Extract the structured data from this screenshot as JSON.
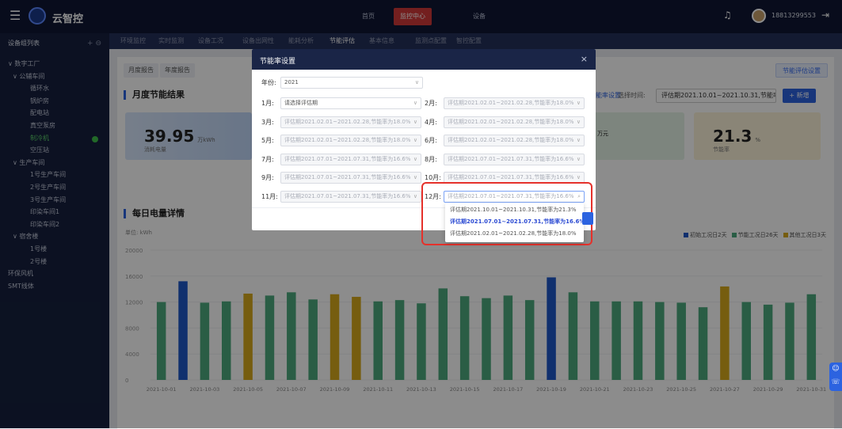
{
  "app": {
    "title": "云智控"
  },
  "nav": [
    {
      "label": "首页"
    },
    {
      "label": "监控中心"
    },
    {
      "label": "设备"
    }
  ],
  "user": {
    "phone": "18813299553"
  },
  "sidebar": {
    "header": "设备组列表",
    "nodes": [
      {
        "label": "数字工厂",
        "level": 0,
        "caret": "∨"
      },
      {
        "label": "公辅车间",
        "level": 1,
        "caret": "∨"
      },
      {
        "label": "循环水",
        "level": 2
      },
      {
        "label": "锅炉房",
        "level": 2
      },
      {
        "label": "配电站",
        "level": 2
      },
      {
        "label": "真空泵房",
        "level": 2
      },
      {
        "label": "制冷机",
        "level": 2,
        "selected": true
      },
      {
        "label": "空压站",
        "level": 2
      },
      {
        "label": "生产车间",
        "level": 1,
        "caret": "∨"
      },
      {
        "label": "1号生产车间",
        "level": 2
      },
      {
        "label": "2号生产车间",
        "level": 2
      },
      {
        "label": "3号生产车间",
        "level": 2
      },
      {
        "label": "印染车间1",
        "level": 2
      },
      {
        "label": "印染车间2",
        "level": 2
      },
      {
        "label": "宿舍楼",
        "level": 1,
        "caret": "∨"
      },
      {
        "label": "1号楼",
        "level": 2
      },
      {
        "label": "2号楼",
        "level": 2
      },
      {
        "label": "环保风机",
        "level": 0
      },
      {
        "label": "SMT线体",
        "level": 0
      }
    ]
  },
  "tabs": [
    "环境监控",
    "实时监测",
    "设备工况",
    "设备出网性",
    "能耗分析",
    "节能评估",
    "基本信息",
    "监测点配置",
    "智控配置"
  ],
  "active_tab": "节能评估",
  "subtabs": [
    "月度报告",
    "年度报告"
  ],
  "plan_button": "节能评估设置",
  "section_monthly": "月度节能结果",
  "section_daily": "每日电量详情",
  "filter": {
    "link": "节能率设置",
    "time_label": "选择时间:",
    "time_value": "评估期2021.10.01~2021.10.31,节能率为2...",
    "add": "+ 新增"
  },
  "cards": {
    "consumption_value": "39.95",
    "consumption_unit": "万kWh",
    "consumption_desc": "消耗电量",
    "money_unit": "万元",
    "rate_value": "21.3",
    "rate_unit": "%",
    "rate_desc": "节能率"
  },
  "chart_data": {
    "type": "bar",
    "ylabel": "单位: kWh",
    "ylim": [
      0,
      20000
    ],
    "yticks": [
      0,
      4000,
      8000,
      12000,
      16000,
      20000
    ],
    "legend": [
      "初始工况日2天",
      "节能工况日26天",
      "其他工况日3天"
    ],
    "colors": {
      "初始工况日2天": "#1e58c8",
      "节能工况日26天": "#4ea97e",
      "其他工况日3天": "#d8a91d"
    },
    "x_labels": [
      "2021-10-01",
      "2021-10-03",
      "2021-10-05",
      "2021-10-07",
      "2021-10-09",
      "2021-10-11",
      "2021-10-13",
      "2021-10-15",
      "2021-10-17",
      "2021-10-19",
      "2021-10-21",
      "2021-10-23",
      "2021-10-25",
      "2021-10-27",
      "2021-10-29",
      "2021-10-31"
    ],
    "values": [
      12000,
      15200,
      11900,
      12100,
      13300,
      13000,
      13500,
      12400,
      13200,
      12800,
      12100,
      12300,
      11800,
      14100,
      12900,
      12600,
      13000,
      12300,
      15800,
      13500,
      12100,
      12100,
      12100,
      12000,
      11900,
      11200,
      14400,
      12000,
      11600,
      11900,
      13200
    ],
    "kinds": [
      "s",
      "b",
      "s",
      "s",
      "o",
      "s",
      "s",
      "s",
      "o",
      "o",
      "s",
      "s",
      "s",
      "s",
      "s",
      "s",
      "s",
      "s",
      "b",
      "s",
      "s",
      "s",
      "s",
      "s",
      "s",
      "s",
      "o",
      "s",
      "s",
      "s",
      "s"
    ]
  },
  "dialog": {
    "title": "节能率设置",
    "close": "×",
    "year_label": "年份:",
    "year_value": "2021",
    "months": [
      {
        "label": "1月:",
        "value": "请选择评估期"
      },
      {
        "label": "2月:",
        "value": "评估期2021.02.01~2021.02.28,节能率为18.0%"
      },
      {
        "label": "3月:",
        "value": "评估期2021.02.01~2021.02.28,节能率为18.0%"
      },
      {
        "label": "4月:",
        "value": "评估期2021.02.01~2021.02.28,节能率为18.0%"
      },
      {
        "label": "5月:",
        "value": "评估期2021.02.01~2021.02.28,节能率为18.0%"
      },
      {
        "label": "6月:",
        "value": "评估期2021.02.01~2021.02.28,节能率为18.0%"
      },
      {
        "label": "7月:",
        "value": "评估期2021.07.01~2021.07.31,节能率为16.6%"
      },
      {
        "label": "8月:",
        "value": "评估期2021.07.01~2021.07.31,节能率为16.6%"
      },
      {
        "label": "9月:",
        "value": "评估期2021.07.01~2021.07.31,节能率为16.6%"
      },
      {
        "label": "10月:",
        "value": "评估期2021.07.01~2021.07.31,节能率为16.6%"
      },
      {
        "label": "11月:",
        "value": "评估期2021.07.01~2021.07.31,节能率为16.6%"
      },
      {
        "label": "12月:",
        "value": "评估期2021.07.01~2021.07.31,节能率为16.6%"
      }
    ],
    "dropdown": [
      "评估期2021.10.01~2021.10.31,节能率为21.3%",
      "评估期2021.07.01~2021.07.31,节能率为16.6%",
      "评估期2021.02.01~2021.02.28,节能率为18.0%"
    ],
    "dropdown_selected": 1
  }
}
